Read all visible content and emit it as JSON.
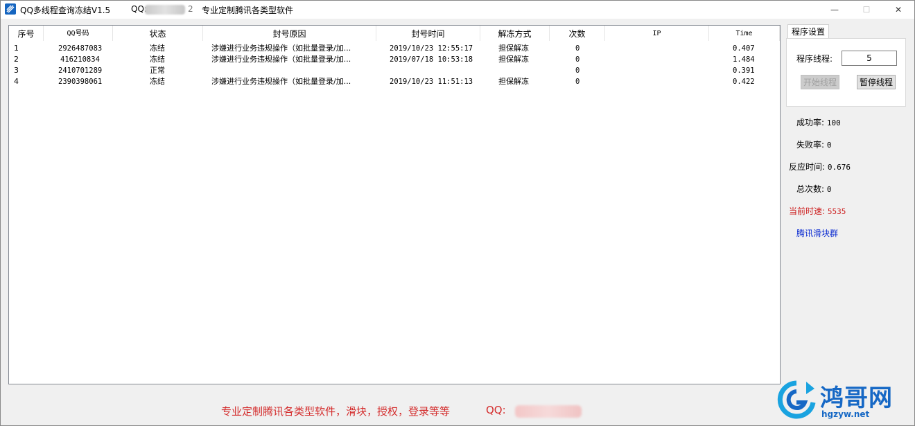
{
  "window": {
    "title": "QQ多线程查询冻结V1.5",
    "title_qq_label": "QQ:",
    "title_qq_tail": "2",
    "title_slogan": "专业定制腾讯各类型软件",
    "controls": {
      "minimize": "—",
      "maximize": "☐",
      "close": "✕"
    }
  },
  "table": {
    "columns": [
      "序号",
      "QQ号码",
      "状态",
      "封号原因",
      "封号时间",
      "解冻方式",
      "次数",
      "IP",
      "Time"
    ],
    "rows": [
      {
        "idx": "1",
        "qq": "2926487083",
        "status": "冻结",
        "reason": "涉嫌进行业务违规操作（如批量登录/加...",
        "time": "2019/10/23 12:55:17",
        "method": "担保解冻",
        "count": "0",
        "ip": "",
        "t": "0.407"
      },
      {
        "idx": "2",
        "qq": "416210834",
        "status": "冻结",
        "reason": "涉嫌进行业务违规操作（如批量登录/加...",
        "time": "2019/07/18 10:53:18",
        "method": "担保解冻",
        "count": "0",
        "ip": "",
        "t": "1.484"
      },
      {
        "idx": "3",
        "qq": "2410701289",
        "status": "正常",
        "reason": "",
        "time": "",
        "method": "",
        "count": "0",
        "ip": "",
        "t": "0.391"
      },
      {
        "idx": "4",
        "qq": "2390398061",
        "status": "冻结",
        "reason": "涉嫌进行业务违规操作（如批量登录/加...",
        "time": "2019/10/23 11:51:13",
        "method": "担保解冻",
        "count": "0",
        "ip": "",
        "t": "0.422"
      }
    ]
  },
  "settings": {
    "tab_label": "程序设置",
    "thread_label": "程序线程:",
    "thread_value": "5",
    "start_button": "开始线程",
    "pause_button": "暂停线程"
  },
  "stats": {
    "success_label": "成功率:",
    "success_value": "100",
    "fail_label": "失败率:",
    "fail_value": "0",
    "response_label": "反应时间:",
    "response_value": "0.676",
    "total_label": "总次数:",
    "total_value": "0",
    "speed_label": "当前时速:",
    "speed_value": "5535",
    "link_label": "腾讯滑块群"
  },
  "footer": {
    "slogan": "专业定制腾讯各类型软件，滑块，授权，登录等等",
    "qq_label": "QQ:"
  },
  "watermark": {
    "name": "鸿哥网",
    "url": "hgzyw.net"
  },
  "colors": {
    "accent_red": "#cc1b1b",
    "link_blue": "#0b2bd1",
    "watermark_blue": "#1668c5"
  }
}
